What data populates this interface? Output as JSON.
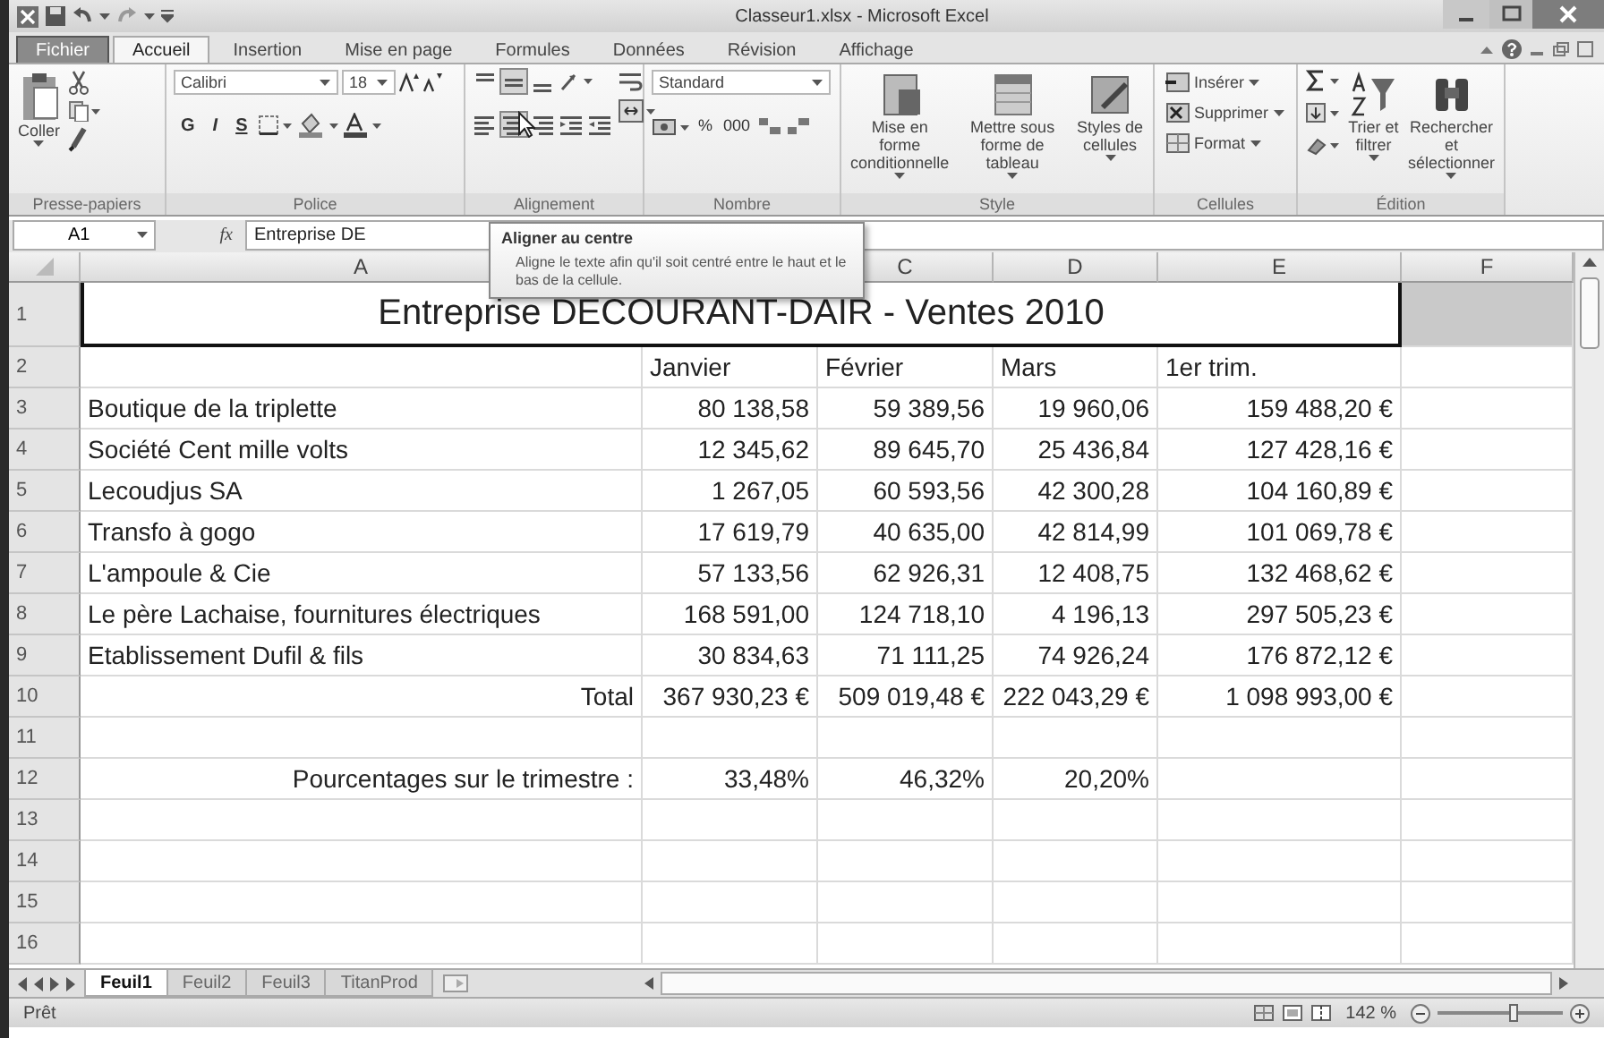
{
  "window": {
    "title": "Classeur1.xlsx - Microsoft Excel"
  },
  "ribbon_tabs": [
    {
      "label": "Fichier",
      "kind": "file",
      "selected": false
    },
    {
      "label": "Accueil",
      "kind": "tab",
      "selected": true
    },
    {
      "label": "Insertion",
      "kind": "tab",
      "selected": false
    },
    {
      "label": "Mise en page",
      "kind": "tab",
      "selected": false
    },
    {
      "label": "Formules",
      "kind": "tab",
      "selected": false
    },
    {
      "label": "Données",
      "kind": "tab",
      "selected": false
    },
    {
      "label": "Révision",
      "kind": "tab",
      "selected": false
    },
    {
      "label": "Affichage",
      "kind": "tab",
      "selected": false
    }
  ],
  "ribbon_groups": [
    {
      "label": "Presse-papiers",
      "kind": "clipboard",
      "buttons": [
        "Coller"
      ]
    },
    {
      "label": "Police",
      "kind": "font",
      "font": "Calibri",
      "size": "18",
      "buttons": [
        "G",
        "I",
        "S"
      ]
    },
    {
      "label": "Alignement",
      "kind": "alignment",
      "middle_on": true,
      "center_on": true
    },
    {
      "label": "Nombre",
      "kind": "number",
      "format": "Standard",
      "buttons": [
        "%",
        "000"
      ]
    },
    {
      "label": "Style",
      "kind": "style",
      "buttons": [
        "Mise en forme conditionnelle",
        "Mettre sous forme de tableau",
        "Styles de cellules"
      ]
    },
    {
      "label": "Cellules",
      "kind": "cells",
      "buttons": [
        "Insérer",
        "Supprimer",
        "Format"
      ]
    },
    {
      "label": "Édition",
      "kind": "editing",
      "buttons": [
        "Trier et filtrer",
        "Rechercher et sélectionner"
      ]
    }
  ],
  "formula_bar": {
    "cell": "A1",
    "function_label": "fx",
    "content": "Entreprise DE"
  },
  "tooltip": {
    "title": "Aligner au centre",
    "text": "Aligne le texte afin qu'il soit centré entre le haut et le bas de la cellule."
  },
  "columns": [
    {
      "kind": "header",
      "label": "A"
    },
    {
      "kind": "covered"
    },
    {
      "kind": "header",
      "label": "C"
    },
    {
      "kind": "header",
      "label": "D"
    },
    {
      "kind": "header",
      "label": "E"
    },
    {
      "kind": "header",
      "label": "F"
    }
  ],
  "rows": [
    {
      "number": "1",
      "kind": "title",
      "cells": {
        "A": "Entreprise DECOURANT-DAIR - Ventes 2010"
      }
    },
    {
      "number": "2",
      "kind": "header",
      "cells": {
        "B": "Janvier",
        "C": "Février",
        "D": "Mars",
        "E": "1er trim."
      }
    },
    {
      "number": "3",
      "kind": "data",
      "cells": {
        "A": "Boutique de la triplette",
        "B": "80 138,58",
        "C": "59 389,56",
        "D": "19 960,06",
        "E": "159 488,20 €"
      }
    },
    {
      "number": "4",
      "kind": "data",
      "cells": {
        "A": "Société Cent mille volts",
        "B": "12 345,62",
        "C": "89 645,70",
        "D": "25 436,84",
        "E": "127 428,16 €"
      }
    },
    {
      "number": "5",
      "kind": "data",
      "cells": {
        "A": "Lecoudjus SA",
        "B": "1 267,05",
        "C": "60 593,56",
        "D": "42 300,28",
        "E": "104 160,89 €"
      }
    },
    {
      "number": "6",
      "kind": "data",
      "cells": {
        "A": "Transfo à gogo",
        "B": "17 619,79",
        "C": "40 635,00",
        "D": "42 814,99",
        "E": "101 069,78 €"
      }
    },
    {
      "number": "7",
      "kind": "data",
      "cells": {
        "A": "L'ampoule & Cie",
        "B": "57 133,56",
        "C": "62 926,31",
        "D": "12 408,75",
        "E": "132 468,62 €"
      }
    },
    {
      "number": "8",
      "kind": "data",
      "cells": {
        "A": "Le père Lachaise, fournitures électriques",
        "B": "168 591,00",
        "C": "124 718,10",
        "D": "4 196,13",
        "E": "297 505,23 €"
      }
    },
    {
      "number": "9",
      "kind": "data",
      "cells": {
        "A": "Etablissement Dufil & fils",
        "B": "30 834,63",
        "C": "71 111,25",
        "D": "74 926,24",
        "E": "176 872,12 €"
      }
    },
    {
      "number": "10",
      "kind": "total",
      "cells": {
        "A": "Total",
        "B": "367 930,23 €",
        "C": "509 019,48 €",
        "D": "222 043,29 €",
        "E": "1 098 993,00 €"
      }
    },
    {
      "number": "11",
      "kind": "empty"
    },
    {
      "number": "12",
      "kind": "total",
      "cells": {
        "A": "Pourcentages sur le trimestre :",
        "B": "33,48%",
        "C": "46,32%",
        "D": "20,20%"
      }
    },
    {
      "number": "13",
      "kind": "empty"
    },
    {
      "number": "14",
      "kind": "empty"
    },
    {
      "number": "15",
      "kind": "empty"
    },
    {
      "number": "16",
      "kind": "empty"
    }
  ],
  "sheet_tabs": [
    {
      "label": "Feuil1",
      "selected": true
    },
    {
      "label": "Feuil2",
      "selected": false
    },
    {
      "label": "Feuil3",
      "selected": false
    },
    {
      "label": "TitanProd",
      "selected": false
    }
  ],
  "status_bar": {
    "status": "Prêt",
    "zoom": "142 %",
    "zoom_slider": {
      "level": 0.6
    }
  }
}
